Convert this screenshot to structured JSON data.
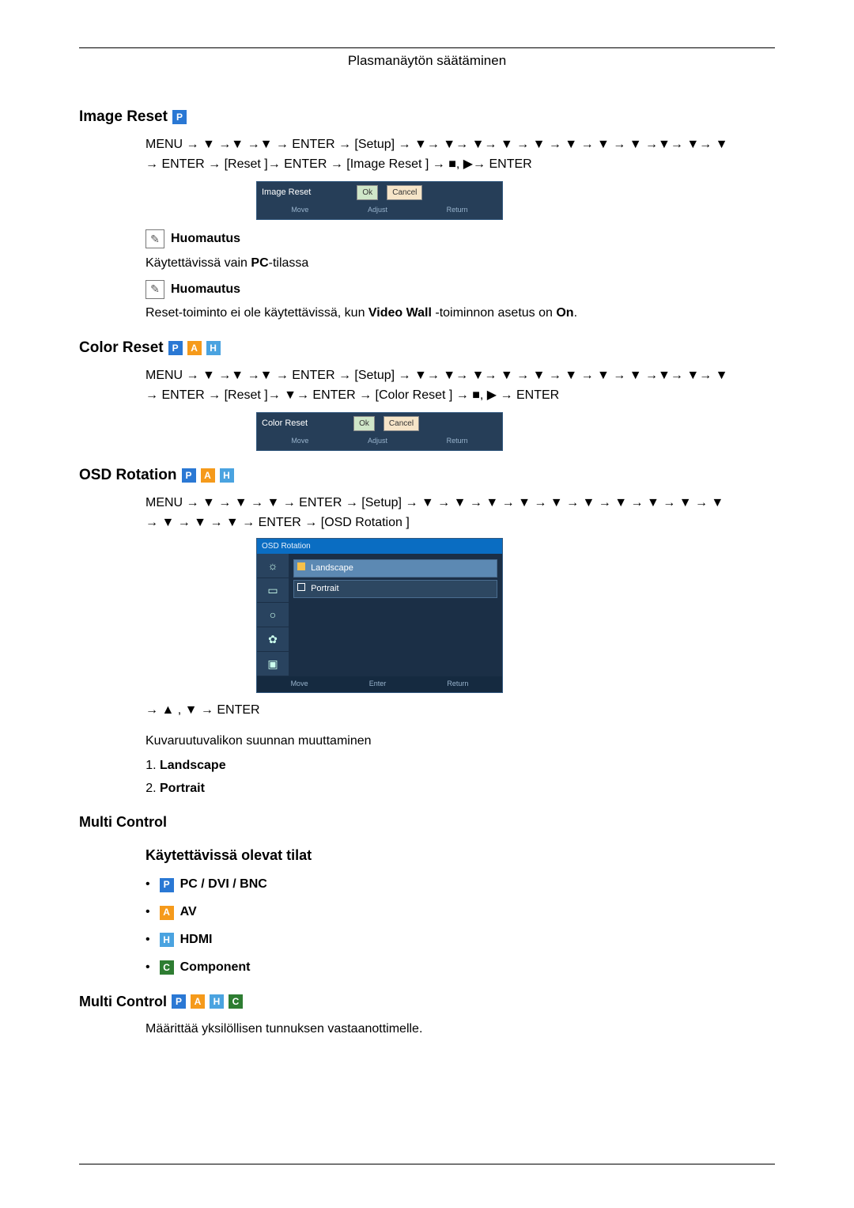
{
  "header": {
    "title": "Plasmanäytön säätäminen"
  },
  "sections": {
    "image_reset": {
      "title": "Image Reset",
      "nav1": "MENU → ▼ →▼ →▼ → ENTER → [Setup] → ▼→ ▼→ ▼→ ▼ → ▼ → ▼ → ▼ → ▼ →▼→ ▼→ ▼",
      "nav2": "→ ENTER → [Reset ]→ ENTER → [Image Reset ] → ■, ▶→ ENTER",
      "strip": {
        "label": "Image Reset",
        "ok": "Ok",
        "cancel": "Cancel",
        "hint_move": "Move",
        "hint_adjust": "Adjust",
        "hint_return": "Return"
      },
      "note1_label": "Huomautus",
      "note1_text": "Käytettävissä vain PC-tilassa",
      "note2_label": "Huomautus",
      "note2_text": "Reset-toiminto ei ole käytettävissä, kun Video Wall -toiminnon asetus on On."
    },
    "color_reset": {
      "title": "Color Reset",
      "nav1": "MENU → ▼ →▼ →▼ → ENTER → [Setup] → ▼→ ▼→ ▼→ ▼ → ▼ → ▼ → ▼ → ▼ →▼→ ▼→ ▼",
      "nav2": "→ ENTER → [Reset ]→ ▼→ ENTER → [Color Reset ] → ■, ▶ → ENTER",
      "strip": {
        "label": "Color Reset",
        "ok": "Ok",
        "cancel": "Cancel",
        "hint_move": "Move",
        "hint_adjust": "Adjust",
        "hint_return": "Return"
      }
    },
    "osd_rotation": {
      "title": "OSD Rotation",
      "nav1": "MENU → ▼ → ▼ → ▼ → ENTER → [Setup] → ▼ → ▼ → ▼ → ▼ → ▼ → ▼ → ▼ → ▼ → ▼ → ▼",
      "nav2": "→ ▼ → ▼ → ▼ → ENTER → [OSD Rotation ]",
      "menu": {
        "title": "OSD Rotation",
        "opt_landscape": "Landscape",
        "opt_portrait": "Portrait",
        "hint_move": "Move",
        "hint_enter": "Enter",
        "hint_return": "Return"
      },
      "nav3": "→ ▲ , ▼ → ENTER",
      "desc": "Kuvaruutuvalikon suunnan muuttaminen",
      "item1": "Landscape",
      "item2": "Portrait"
    },
    "multi_control": {
      "title": "Multi Control",
      "subtitle": "Käytettävissä olevat tilat",
      "mode_pc": "PC / DVI / BNC",
      "mode_av": "AV",
      "mode_hdmi": "HDMI",
      "mode_component": "Component"
    },
    "multi_control2": {
      "title": "Multi Control",
      "desc": "Määrittää yksilöllisen tunnuksen vastaanottimelle."
    }
  }
}
